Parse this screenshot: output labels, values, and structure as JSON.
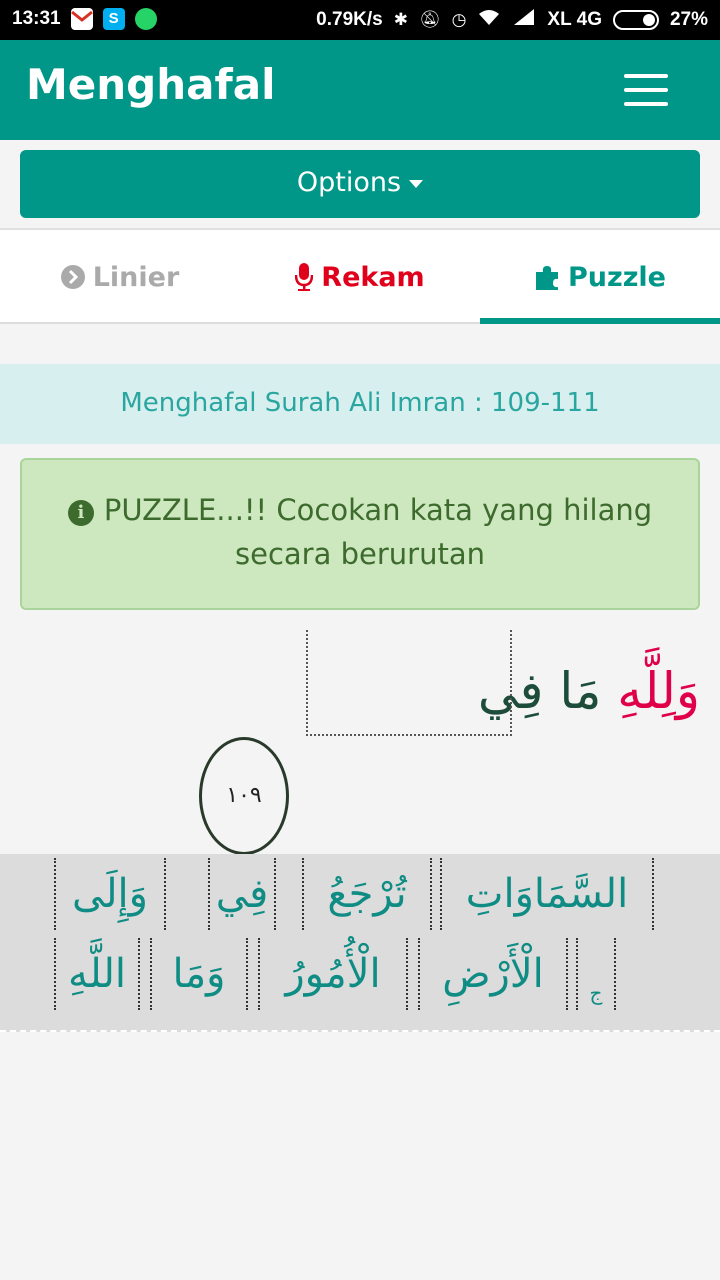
{
  "status_bar": {
    "time": "13:31",
    "net_speed": "0.79K/s",
    "carrier": "XL 4G",
    "battery": "27%",
    "icons": [
      "gmail-icon",
      "skype-icon",
      "whatsapp-icon",
      "bluetooth-icon",
      "mute-icon",
      "alarm-icon",
      "wifi-icon",
      "signal-icon",
      "battery-icon"
    ]
  },
  "app_bar": {
    "title": "Menghafal",
    "menu_icon": "hamburger-menu-icon"
  },
  "options": {
    "label": "Options"
  },
  "tabs": [
    {
      "label": "Linier",
      "icon": "chevron-circle-right-icon",
      "color": "#aaaaaa"
    },
    {
      "label": "Rekam",
      "icon": "microphone-icon",
      "color": "#e0001b"
    },
    {
      "label": "Puzzle",
      "icon": "puzzle-piece-icon",
      "color": "#009688",
      "active": true
    }
  ],
  "surah_info": "Menghafal Surah Ali Imran : 109-111",
  "alert": {
    "icon": "info-circle-icon",
    "text": "PUZZLE...!! Cocokan kata yang hilang secara berurutan"
  },
  "verse": {
    "highlight": "وَلِلَّهِ",
    "rest": " مَا فِي",
    "ayah_number": "١٠٩"
  },
  "word_choices": [
    "السَّمَاوَاتِ",
    "تُرْجَعُ",
    "فِي",
    "وَإِلَى",
    "ج",
    "الْأَرْضِ",
    "الْأُمُورُ",
    "وَمَا",
    "اللَّهِ"
  ],
  "colors": {
    "primary": "#009688",
    "accent_red": "#e0001b",
    "alert_bg": "#cde7bf",
    "surah_bg": "#d7efee"
  }
}
